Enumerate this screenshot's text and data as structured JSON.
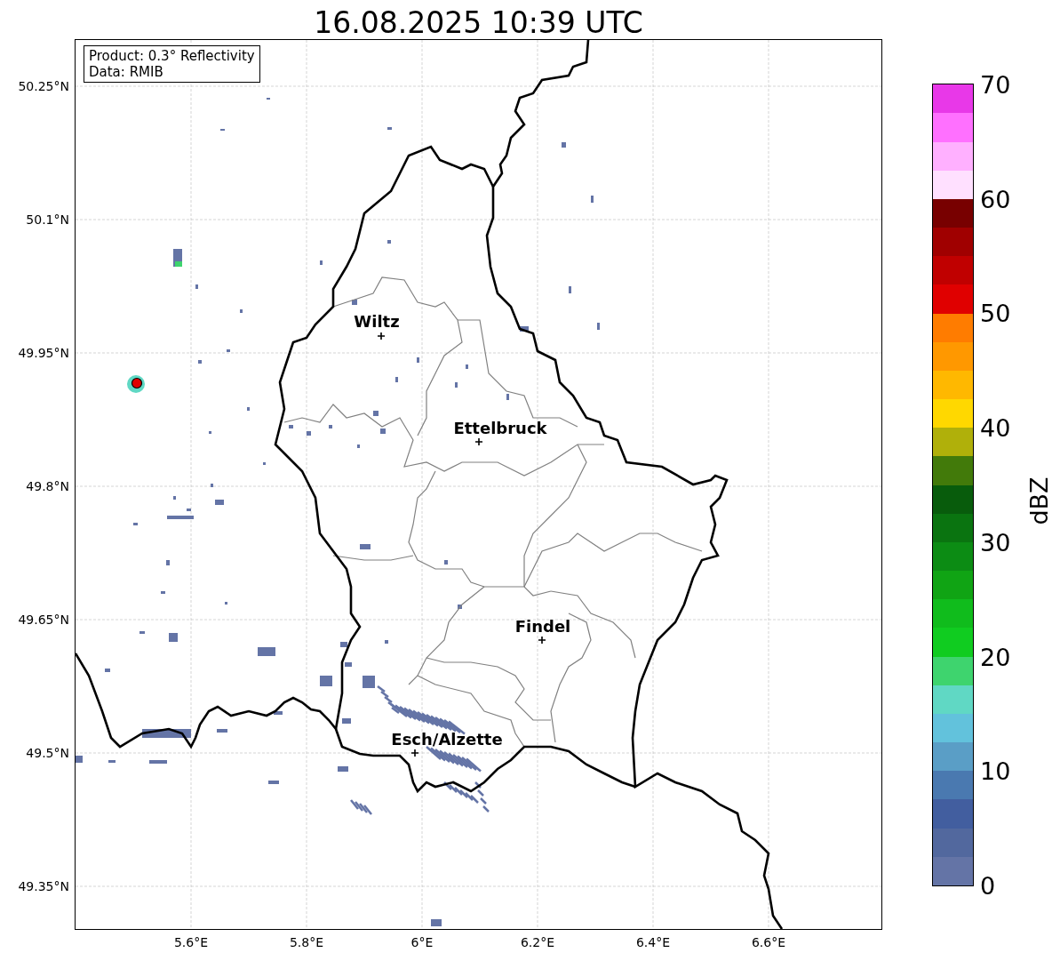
{
  "title": "16.08.2025 10:39 UTC",
  "legend": {
    "lines": [
      "Product: 0.3° Reflectivity",
      "Data: RMIB"
    ]
  },
  "map": {
    "yticks": [
      "50.25°N",
      "50.1°N",
      "49.95°N",
      "49.8°N",
      "49.65°N",
      "49.5°N",
      "49.35°N"
    ],
    "xticks": [
      "5.6°E",
      "5.8°E",
      "6°E",
      "6.2°E",
      "6.4°E",
      "6.6°E"
    ],
    "cities": [
      {
        "name": "Wiltz"
      },
      {
        "name": "Ettelbruck"
      },
      {
        "name": "Findel"
      },
      {
        "name": "Esch/Alzette"
      }
    ]
  },
  "colorbar": {
    "label": "dBZ",
    "ticks": [
      "70",
      "60",
      "50",
      "40",
      "30",
      "20",
      "10",
      "0"
    ],
    "segments": [
      {
        "color": "#6474a6"
      },
      {
        "color": "#52689e"
      },
      {
        "color": "#425e9f"
      },
      {
        "color": "#4a79b0"
      },
      {
        "color": "#5a9ec6"
      },
      {
        "color": "#62c2dc"
      },
      {
        "color": "#60d8c4"
      },
      {
        "color": "#3ed46e"
      },
      {
        "color": "#10cc20"
      },
      {
        "color": "#10bc1c"
      },
      {
        "color": "#10a414"
      },
      {
        "color": "#0c8c14"
      },
      {
        "color": "#0a7410"
      },
      {
        "color": "#085c0c"
      },
      {
        "color": "#427a0a"
      },
      {
        "color": "#b0b00a"
      },
      {
        "color": "#ffd800"
      },
      {
        "color": "#ffb800"
      },
      {
        "color": "#ff9800"
      },
      {
        "color": "#ff7c00"
      },
      {
        "color": "#e00000"
      },
      {
        "color": "#c00000"
      },
      {
        "color": "#a00000"
      },
      {
        "color": "#780000"
      },
      {
        "color": "#ffe0ff"
      },
      {
        "color": "#ffb0ff"
      },
      {
        "color": "#ff70ff"
      },
      {
        "color": "#e838e8"
      }
    ]
  }
}
